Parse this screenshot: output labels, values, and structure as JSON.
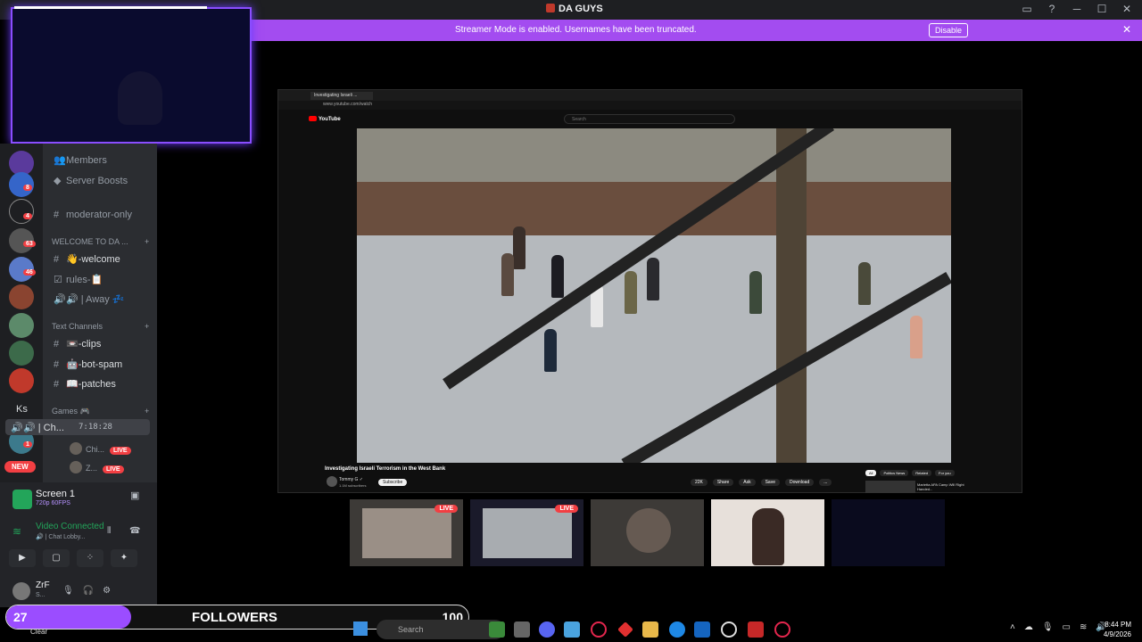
{
  "window": {
    "title": "DA GUYS"
  },
  "streamer_mode": {
    "message": "Streamer Mode is enabled. Usernames have been truncated.",
    "button": "Disable"
  },
  "server_rail": {
    "badges": [
      "8",
      "4",
      "63",
      "46",
      "1"
    ],
    "text_server": "Ks",
    "new_label": "NEW"
  },
  "channels": {
    "members": "Members",
    "server_boosts": "Server Boosts",
    "moderator_only": "moderator-only",
    "cat_welcome": "WELCOME TO DA ...",
    "welcome": "👋-welcome",
    "rules": "rules-📋",
    "away": "🔊 | Away 💤",
    "cat_text": "Text Channels",
    "clips": "📼-clips",
    "bot_spam": "🤖-bot-spam",
    "patches": "📖-patches",
    "cat_games": "Games 🎮",
    "voice_chat": "🔊 | Ch...",
    "voice_time": "7:18:28",
    "users": [
      {
        "name": "Chi...",
        "live": "LIVE"
      },
      {
        "name": "Z...",
        "live": "LIVE"
      }
    ]
  },
  "screen_panel": {
    "title": "Screen 1",
    "subtitle": "720p 60FPS",
    "voice_connected": "Video Connected",
    "voice_sub": "🔊 | Chat Lobby...",
    "user": "ZrF",
    "user_sub": "S..."
  },
  "browser": {
    "tab_title": "Investigating Israeli ...",
    "url": "www.youtube.com/watch",
    "search_placeholder": "Search",
    "logo": "YouTube",
    "video_title": "Investigating Israeli Terrorism in the West Bank",
    "channel": "Tommy G ✓",
    "channel_sub": "1.1M subscribers",
    "subscribe": "Subscribe",
    "actions": [
      "22K",
      "Share",
      "Ask",
      "Save",
      "Download",
      "..."
    ],
    "chips": [
      "All",
      "Politics News",
      "Related",
      "For you"
    ],
    "side_title": "Marietta APA Camp Will Right Handed..."
  },
  "thumbnails": {
    "live": "LIVE"
  },
  "followers": {
    "count": "27",
    "label": "FOLLOWERS",
    "goal": "100",
    "progress": 0.27
  },
  "taskbar": {
    "search": "Search",
    "clear": "Clear",
    "time": "8:44 PM",
    "date": "4/9/2026"
  }
}
